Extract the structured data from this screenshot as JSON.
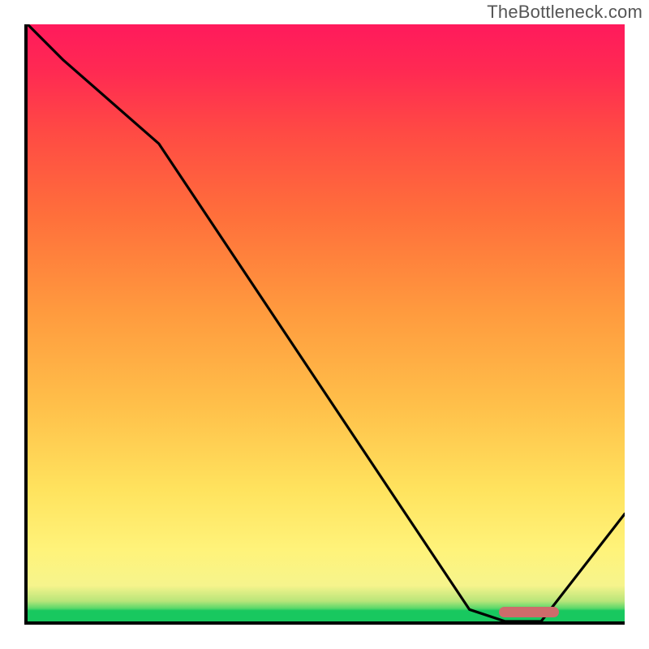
{
  "watermark": "TheBottleneck.com",
  "chart_data": {
    "type": "line",
    "title": "",
    "xlabel": "",
    "ylabel": "",
    "xlim": [
      0,
      100
    ],
    "ylim": [
      0,
      100
    ],
    "grid": false,
    "legend": "none",
    "background": {
      "description": "vertical gradient representing bottleneck severity",
      "stops": [
        {
          "pos": 0,
          "color": "#18c85f",
          "meaning": "optimal / no bottleneck"
        },
        {
          "pos": 6,
          "color": "#f6f48c"
        },
        {
          "pos": 50,
          "color": "#ff9a3e"
        },
        {
          "pos": 100,
          "color": "#ff1a5c",
          "meaning": "severe bottleneck"
        }
      ]
    },
    "series": [
      {
        "name": "bottleneck-curve",
        "x": [
          0,
          6,
          22,
          74,
          80,
          86,
          100
        ],
        "values": [
          100,
          94,
          80,
          2,
          0,
          0,
          18
        ]
      }
    ],
    "optimal_range_x": [
      79,
      89
    ],
    "annotations": []
  },
  "colors": {
    "axis": "#000000",
    "curve": "#000000",
    "marker": "#ce6b6b",
    "watermark": "#555555"
  }
}
